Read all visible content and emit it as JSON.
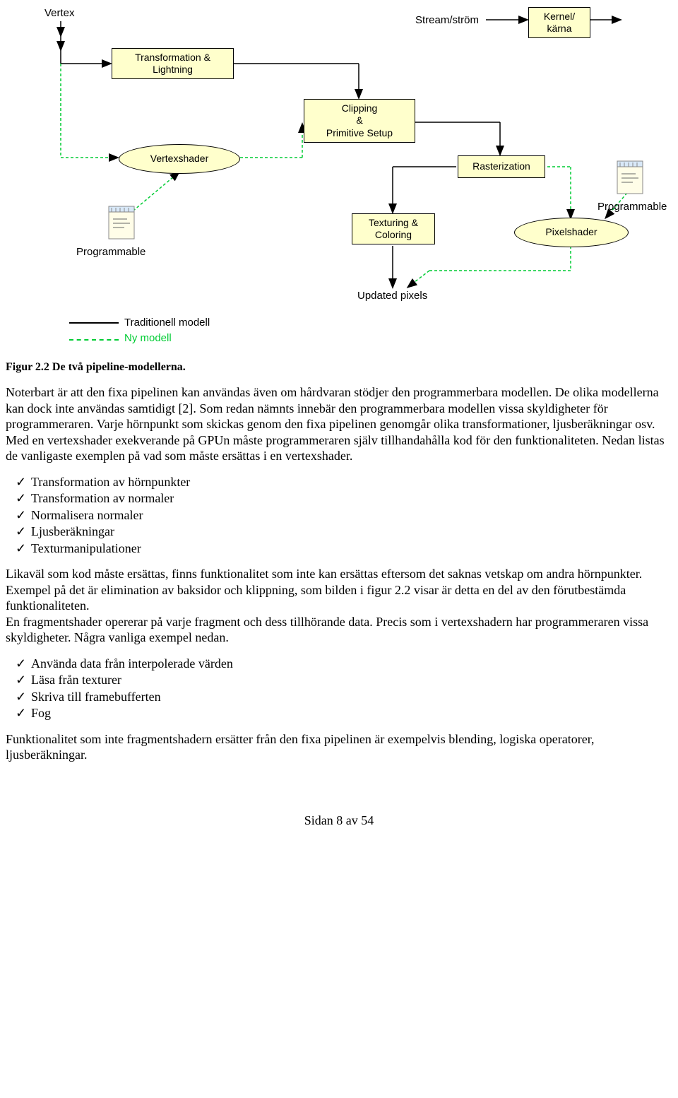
{
  "diagram": {
    "vertex": "Vertex",
    "stream": "Stream/ström",
    "kernel": "Kernel/\nkärna",
    "transformation": "Transformation &\nLightning",
    "clipping": "Clipping\n&\nPrimitive Setup",
    "rasterization": "Rasterization",
    "texturing": "Texturing &\nColoring",
    "vertexshader": "Vertexshader",
    "pixelshader": "Pixelshader",
    "programmable1": "Programmable",
    "programmable2": "Programmable",
    "updated": "Updated pixels",
    "legend_trad": "Traditionell modell",
    "legend_new": "Ny modell"
  },
  "caption": "Figur 2.2 De två pipeline-modellerna.",
  "para1": "Noterbart är att den fixa pipelinen kan användas även om hårdvaran stödjer den programmerbara modellen. De olika modellerna kan dock inte användas samtidigt [2]. Som redan nämnts innebär den programmerbara modellen vissa skyldigheter för programmeraren. Varje hörnpunkt som skickas genom den fixa pipelinen genomgår olika transformationer, ljusberäkningar osv. Med en vertexshader exekverande på GPUn måste programmeraren själv tillhandahålla kod för den funktionaliteten. Nedan listas de vanligaste exemplen på vad som måste ersättas i en vertexshader.",
  "list1": {
    "i0": "Transformation av hörnpunkter",
    "i1": "Transformation av normaler",
    "i2": "Normalisera normaler",
    "i3": "Ljusberäkningar",
    "i4": "Texturmanipulationer"
  },
  "para2": "Likaväl som kod måste ersättas, finns funktionalitet som inte kan ersättas eftersom det saknas vetskap om andra hörnpunkter. Exempel på det är elimination av baksidor och klippning, som bilden i figur 2.2 visar är detta en del av den förutbestämda funktionaliteten.\nEn fragmentshader opererar på varje fragment och dess tillhörande data. Precis som i vertexshadern har programmeraren vissa skyldigheter. Några vanliga exempel nedan.",
  "list2": {
    "i0": "Använda data från interpolerade värden",
    "i1": "Läsa från texturer",
    "i2": "Skriva till framebufferten",
    "i3": "Fog"
  },
  "para3": "Funktionalitet som inte fragmentshadern ersätter från den fixa pipelinen är exempelvis blending, logiska operatorer, ljusberäkningar.",
  "footer": "Sidan 8 av 54"
}
